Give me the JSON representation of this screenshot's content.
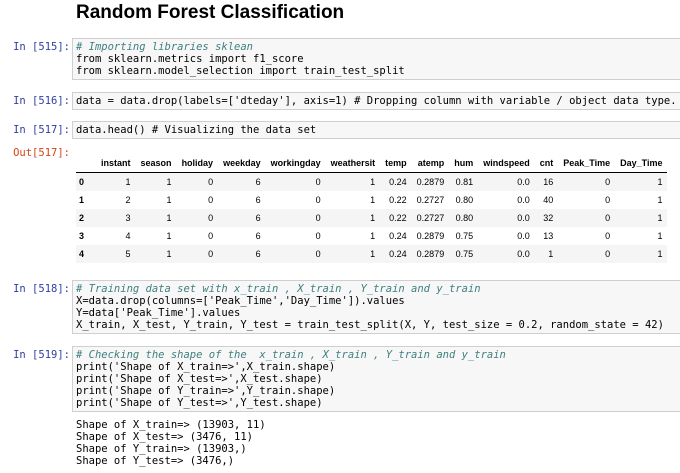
{
  "page_title": "Random Forest Classification",
  "cells": [
    {
      "prompt": "In [515]:",
      "lines": [
        "# Importing libraries sklean",
        "from sklearn.metrics import f1_score",
        "from sklearn.model_selection import train_test_split"
      ]
    },
    {
      "prompt": "In [516]:",
      "lines": [
        "data = data.drop(labels=['dteday'], axis=1) # Dropping column with variable / object data type."
      ]
    },
    {
      "prompt": "In [517]:",
      "lines": [
        "data.head() # Visualizing the data set"
      ]
    },
    {
      "prompt": "In [518]:",
      "lines": [
        "# Training data set with x_train , X_train , Y_train and y_train",
        "X=data.drop(columns=['Peak_Time','Day_Time']).values",
        "Y=data['Peak_Time'].values",
        "X_train, X_test, Y_train, Y_test = train_test_split(X, Y, test_size = 0.2, random_state = 42)"
      ]
    },
    {
      "prompt": "In [519]:",
      "lines": [
        "# Checking the shape of the  x_train , X_train , Y_train and y_train",
        "print('Shape of X_train=>',X_train.shape)",
        "print('Shape of X_test=>',X_test.shape)",
        "print('Shape of Y_train=>',Y_train.shape)",
        "print('Shape of Y_test=>',Y_test.shape)"
      ]
    }
  ],
  "out_prompt": "Out[517]:",
  "table": {
    "columns": [
      "",
      "instant",
      "season",
      "holiday",
      "weekday",
      "workingday",
      "weathersit",
      "temp",
      "atemp",
      "hum",
      "windspeed",
      "cnt",
      "Peak_Time",
      "Day_Time"
    ],
    "rows": [
      [
        "0",
        "1",
        "1",
        "0",
        "6",
        "0",
        "1",
        "0.24",
        "0.2879",
        "0.81",
        "0.0",
        "16",
        "0",
        "1"
      ],
      [
        "1",
        "2",
        "1",
        "0",
        "6",
        "0",
        "1",
        "0.22",
        "0.2727",
        "0.80",
        "0.0",
        "40",
        "0",
        "1"
      ],
      [
        "2",
        "3",
        "1",
        "0",
        "6",
        "0",
        "1",
        "0.22",
        "0.2727",
        "0.80",
        "0.0",
        "32",
        "0",
        "1"
      ],
      [
        "3",
        "4",
        "1",
        "0",
        "6",
        "0",
        "1",
        "0.24",
        "0.2879",
        "0.75",
        "0.0",
        "13",
        "0",
        "1"
      ],
      [
        "4",
        "5",
        "1",
        "0",
        "6",
        "0",
        "1",
        "0.24",
        "0.2879",
        "0.75",
        "0.0",
        "1",
        "0",
        "1"
      ]
    ]
  },
  "output_519": [
    "Shape of X_train=> (13903, 11)",
    "Shape of X_test=> (3476, 11)",
    "Shape of Y_train=> (13903,)",
    "Shape of Y_test=> (3476,)"
  ]
}
